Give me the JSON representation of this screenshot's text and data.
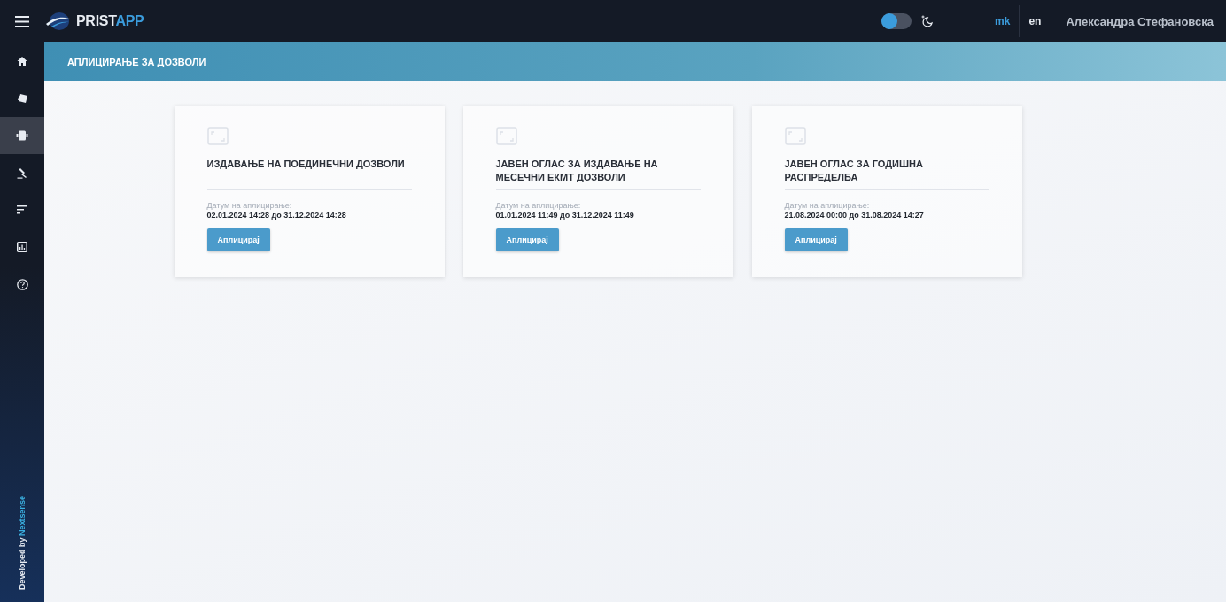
{
  "topbar": {
    "brand_main": "PRIST",
    "brand_accent": "APP",
    "theme_toggle": {
      "on": false
    },
    "languages": [
      {
        "label": "mk",
        "selected": true
      },
      {
        "label": "en",
        "selected": false
      }
    ],
    "user": "Александра Стефановска"
  },
  "sidebar": {
    "items": [
      {
        "kind": "home",
        "selected": false
      },
      {
        "kind": "cards",
        "selected": false
      },
      {
        "kind": "device",
        "selected": true
      },
      {
        "kind": "gavel",
        "selected": false
      },
      {
        "kind": "filter",
        "selected": false
      },
      {
        "kind": "chart",
        "selected": false
      },
      {
        "kind": "help",
        "selected": false
      }
    ],
    "credit": "Developed by",
    "credit_brand": "Nextsense"
  },
  "page_header": "АПЛИЦИРАЊЕ ЗА ДОЗВОЛИ",
  "cards": [
    {
      "title": "ИЗДАВАЊЕ НА ПОЕДИНЕЧНИ ДОЗВОЛИ",
      "date_label": "Датум на аплицирање:",
      "date_range": "02.01.2024 14:28 до 31.12.2024 14:28",
      "button": "Аплицирај"
    },
    {
      "title": "ЈАВЕН ОГЛАС ЗА ИЗДАВАЊЕ НА МЕСЕЧНИ ЕКМТ ДОЗВОЛИ",
      "date_label": "Датум на аплицирање:",
      "date_range": "01.01.2024 11:49 до 31.12.2024 11:49",
      "button": "Аплицирај"
    },
    {
      "title": "ЈАВЕН ОГЛАС ЗА ГОДИШНА РАСПРЕДЕЛБА",
      "date_label": "Датум на аплицирање:",
      "date_range": "21.08.2024 00:00 до 31.08.2024 14:27",
      "button": "Аплицирај"
    }
  ]
}
